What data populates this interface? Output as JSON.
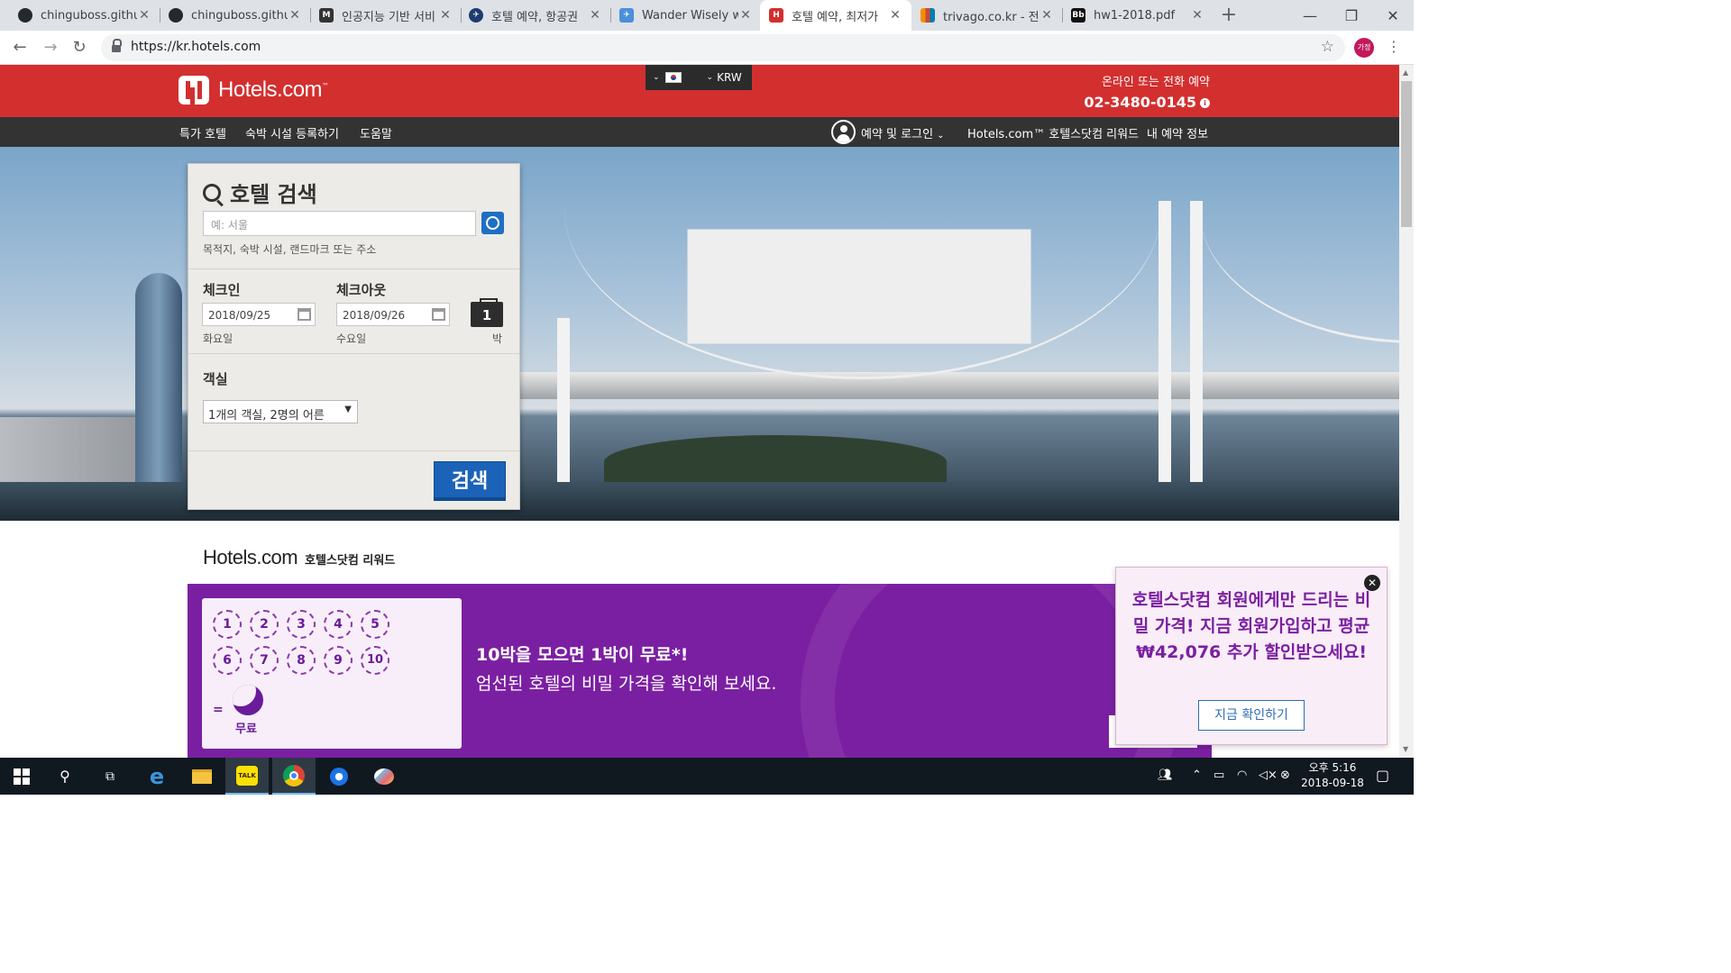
{
  "browser": {
    "tabs": [
      {
        "title": "chinguboss.github",
        "favicon": "github-icon",
        "color": "#24292e"
      },
      {
        "title": "chinguboss.github",
        "favicon": "github-icon",
        "color": "#24292e"
      },
      {
        "title": "인공지능 기반 서비",
        "favicon": "medium-icon",
        "color": "#333333"
      },
      {
        "title": "호텔 예약, 항공권",
        "favicon": "globe-plane-icon",
        "color": "#1f3b70"
      },
      {
        "title": "Wander Wisely wi",
        "favicon": "plane-icon",
        "color": "#4a90d9"
      },
      {
        "title": "호텔 예약, 최저가",
        "favicon": "hotels-icon",
        "color": "#d32f2f",
        "active": true
      },
      {
        "title": "trivago.co.kr - 전",
        "favicon": "trivago-icon",
        "color": "#f48f00"
      },
      {
        "title": "hw1-2018.pdf",
        "favicon": "blackboard-icon",
        "color": "#111111"
      }
    ],
    "url": "https://kr.hotels.com",
    "profile_initials": "가정"
  },
  "header": {
    "logo": "Hotels.com",
    "logo_tm": "™",
    "currency": "KRW",
    "phone_label": "온라인 또는 전화 예약",
    "phone": "02-3480-0145",
    "brand_color": "#d32f2f"
  },
  "nav": {
    "left": [
      "특가 호텔",
      "숙박 시설 등록하기",
      "도움말"
    ],
    "login": "예약 및 로그인",
    "rewards": "Hotels.com™ 호텔스닷컴 리워드",
    "my_booking": "내 예약 정보"
  },
  "search": {
    "title": "호텔 검색",
    "destination_placeholder": "예: 서울",
    "destination_hint": "목적지, 숙박 시설, 랜드마크 또는 주소",
    "checkin_label": "체크인",
    "checkout_label": "체크아웃",
    "checkin_date": "2018/09/25",
    "checkout_date": "2018/09/26",
    "checkin_day": "화요일",
    "checkout_day": "수요일",
    "nights": "1",
    "nights_unit": "박",
    "rooms_label": "객실",
    "rooms_value": "1개의 객실, 2명의 어른",
    "search_button": "검색"
  },
  "rewards": {
    "logo": "Hotels.com",
    "title": "호텔스닷컴 리워드",
    "stamps": [
      "1",
      "2",
      "3",
      "4",
      "5",
      "6",
      "7",
      "8",
      "9",
      "10"
    ],
    "equals": "=",
    "free": "무료",
    "headline": "10박을 모으면 1박이 무료*!",
    "subline": "엄선된 호텔의 비밀 가격을 확인해 보세요."
  },
  "popup": {
    "text": "호텔스닷컴 회원에게만 드리는 비밀 가격! 지금 회원가입하고 평균 ₩42,076 추가 할인받으세요!",
    "button": "지금 확인하기"
  },
  "taskbar": {
    "time": "오후 5:16",
    "date": "2018-09-18",
    "kakao": "TALK"
  }
}
